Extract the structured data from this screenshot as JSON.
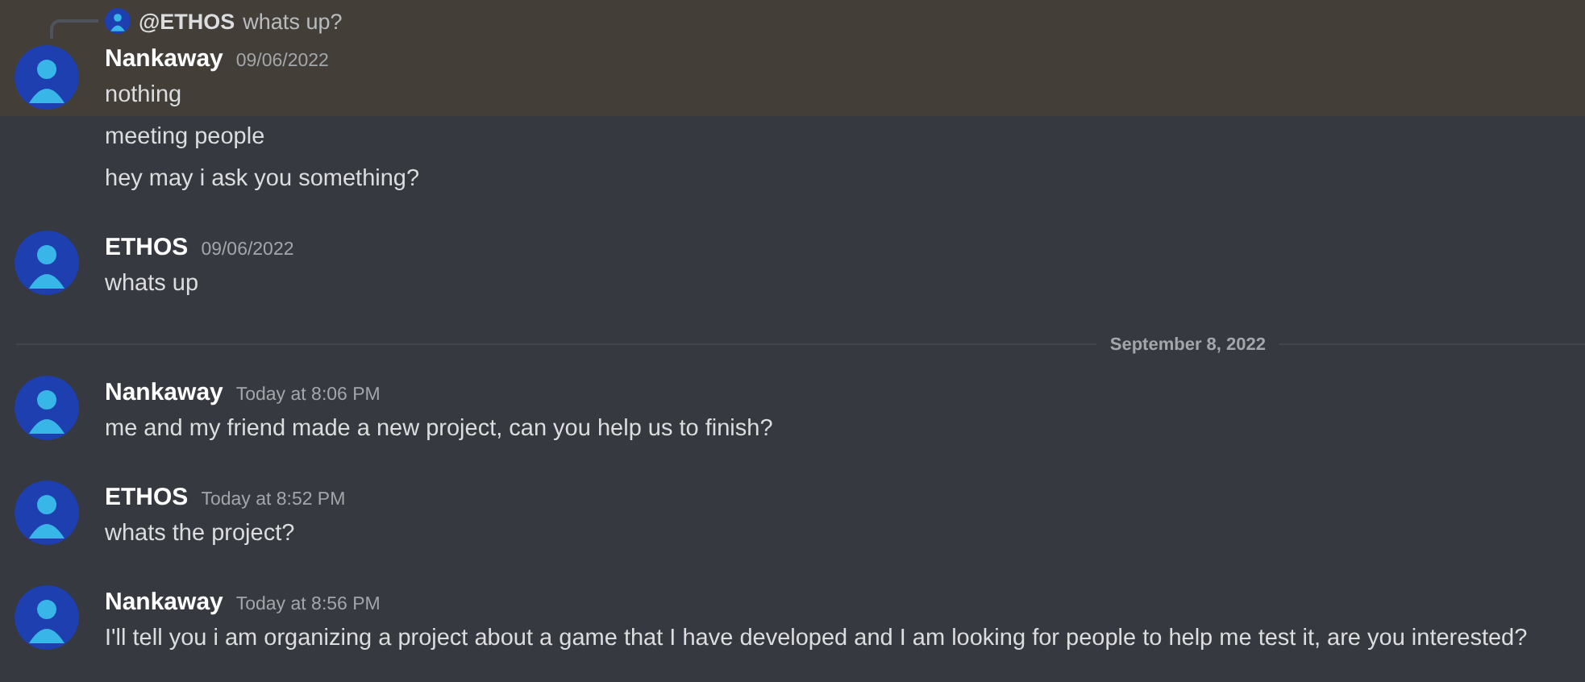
{
  "messages": [
    {
      "kind": "message",
      "highlighted": true,
      "reply": {
        "author": "@ETHOS",
        "text": "whats up?"
      },
      "author": "Nankaway",
      "timestamp": "09/06/2022",
      "text": "nothing"
    },
    {
      "kind": "continuation",
      "highlighted": false,
      "text": "meeting people"
    },
    {
      "kind": "continuation",
      "highlighted": false,
      "text": "hey may i ask you something?"
    },
    {
      "kind": "message",
      "highlighted": false,
      "author": "ETHOS",
      "timestamp": "09/06/2022",
      "text": "whats up"
    },
    {
      "kind": "divider",
      "text": "September 8, 2022"
    },
    {
      "kind": "message",
      "highlighted": false,
      "author": "Nankaway",
      "timestamp": "Today at 8:06 PM",
      "text": "me and my friend made a new project, can you help us to finish?"
    },
    {
      "kind": "message",
      "highlighted": false,
      "author": "ETHOS",
      "timestamp": "Today at 8:52 PM",
      "text": "whats the project?"
    },
    {
      "kind": "message",
      "highlighted": false,
      "author": "Nankaway",
      "timestamp": "Today at 8:56 PM",
      "text": "I'll tell you i am organizing a project about a game that I have developed and I am looking for people to help me test it, are you interested?"
    }
  ]
}
